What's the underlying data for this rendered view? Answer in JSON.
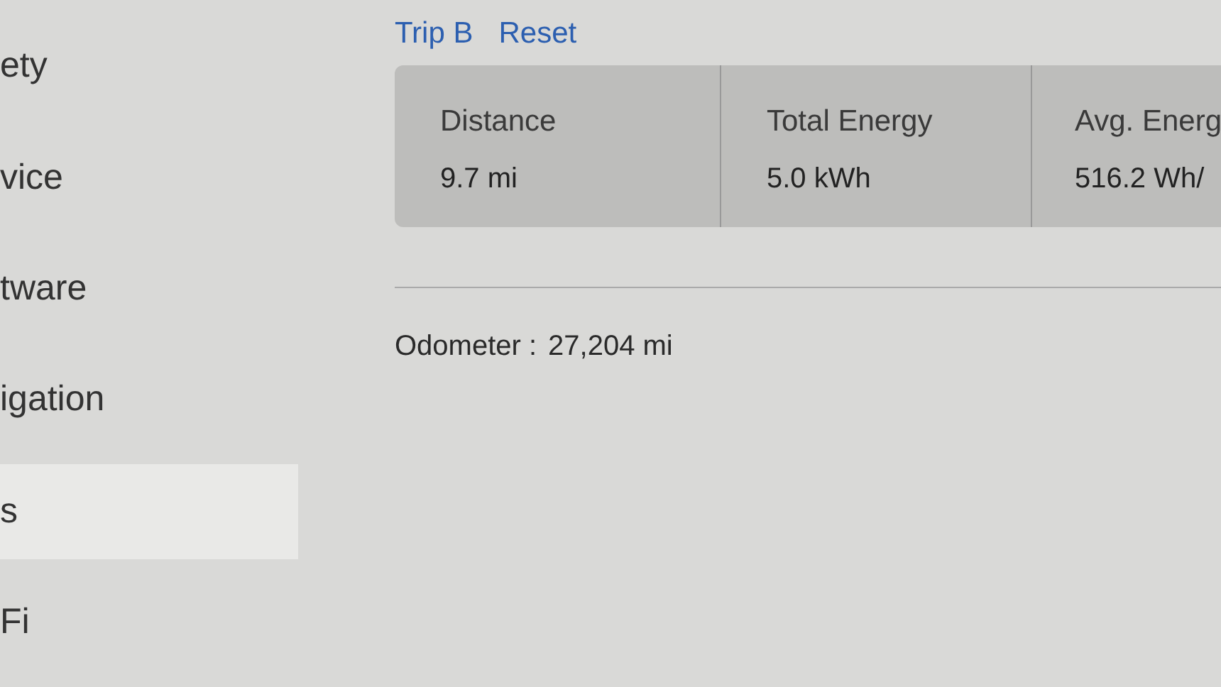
{
  "sidebar": {
    "items": [
      {
        "label": "ety",
        "selected": false
      },
      {
        "label": "vice",
        "selected": false
      },
      {
        "label": "tware",
        "selected": false
      },
      {
        "label": "igation",
        "selected": false
      },
      {
        "label": "s",
        "selected": true
      },
      {
        "label": "Fi",
        "selected": false
      }
    ]
  },
  "trip_links": [
    "Trip B",
    "Reset"
  ],
  "trip_stats": [
    {
      "label": "Distance",
      "value": "9.7 mi"
    },
    {
      "label": "Total Energy",
      "value": "5.0 kWh"
    },
    {
      "label": "Avg. Energ",
      "value": "516.2 Wh/"
    }
  ],
  "odometer": {
    "label": "Odometer :",
    "value": "27,204 mi"
  }
}
